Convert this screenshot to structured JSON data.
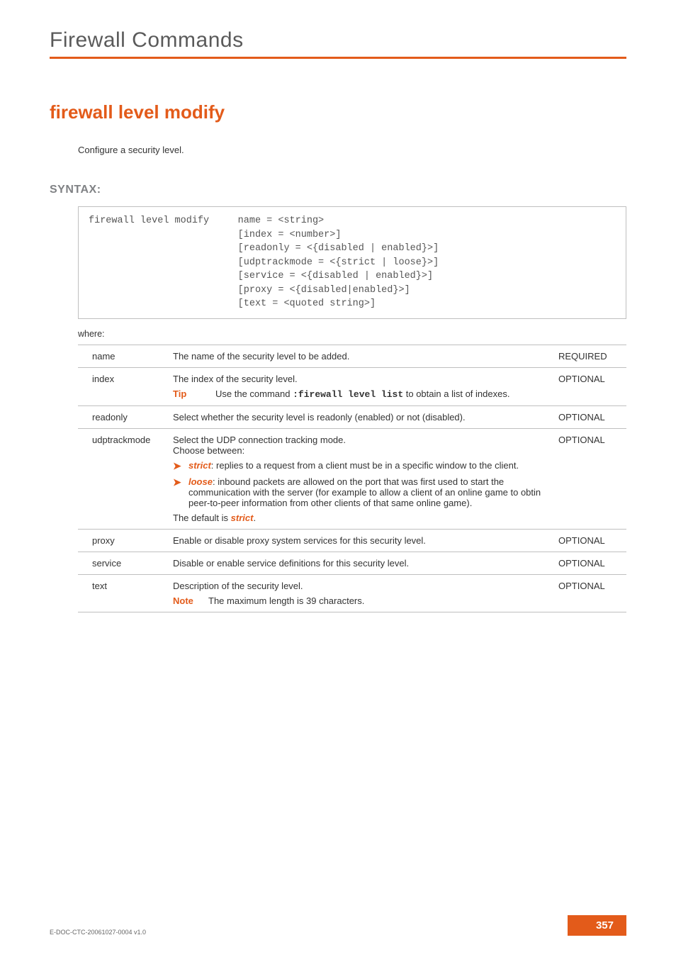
{
  "header": {
    "running": "Firewall Commands"
  },
  "title": "firewall level modify",
  "intro": "Configure a security level.",
  "syntax": {
    "heading": "SYNTAX:",
    "block": "firewall level modify     name = <string>\n                          [index = <number>]\n                          [readonly = <{disabled | enabled}>]\n                          [udptrackmode = <{strict | loose}>]\n                          [service = <{disabled | enabled}>]\n                          [proxy = <{disabled|enabled}>]\n                          [text = <quoted string>]"
  },
  "where_label": "where:",
  "params": {
    "name": {
      "label": "name",
      "req": "REQUIRED",
      "desc": "The name of the security level to be added."
    },
    "index": {
      "label": "index",
      "req": "OPTIONAL",
      "line1": "The index of the security level.",
      "tip_label": "Tip",
      "tip_pre": "Use the command ",
      "tip_cmd": ":firewall level list",
      "tip_post": " to obtain a list of indexes."
    },
    "readonly": {
      "label": "readonly",
      "req": "OPTIONAL",
      "desc": "Select whether the security level is readonly (enabled) or not (disabled)."
    },
    "udp": {
      "label": "udptrackmode",
      "req": "OPTIONAL",
      "intro1": "Select the UDP connection tracking mode.",
      "intro2": "Choose between:",
      "strict_label": "strict",
      "strict_text": ": replies to a request from a client must be in a specific window to the client.",
      "loose_label": "loose",
      "loose_text": ": inbound packets are allowed on the port that was first used to start the communication with the server (for example to allow a client of an online game to obtin peer-to-peer information from other clients of that same online game).",
      "default_pre": "The default is ",
      "default_val": "strict",
      "default_post": "."
    },
    "proxy": {
      "label": "proxy",
      "req": "OPTIONAL",
      "desc": "Enable or disable proxy system services for this security level."
    },
    "service": {
      "label": "service",
      "req": "OPTIONAL",
      "desc": "Disable or enable service definitions for this security level."
    },
    "text": {
      "label": "text",
      "req": "OPTIONAL",
      "line1": "Description of the security level.",
      "note_label": "Note",
      "note_text": "The maximum length is 39 characters."
    }
  },
  "footer": {
    "docid": "E-DOC-CTC-20061027-0004 v1.0",
    "page": "357"
  }
}
